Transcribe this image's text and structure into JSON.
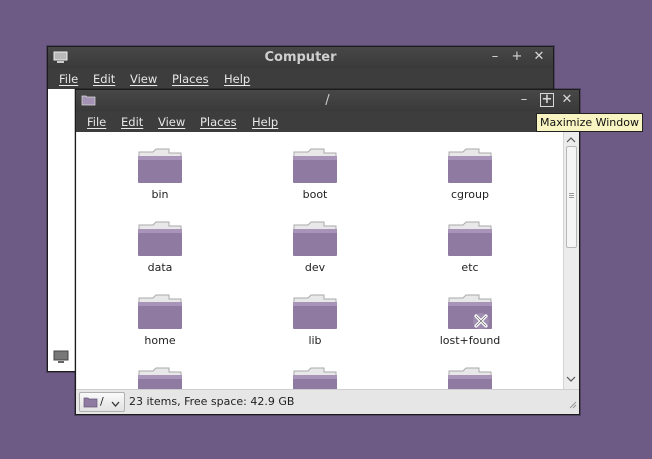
{
  "back_window": {
    "title": "Computer",
    "menu": [
      "File",
      "Edit",
      "View",
      "Places",
      "Help"
    ],
    "controls": {
      "minimize": "–",
      "maximize": "+",
      "close": "✕"
    }
  },
  "front_window": {
    "title": "/",
    "menu": [
      "File",
      "Edit",
      "View",
      "Places",
      "Help"
    ],
    "controls": {
      "minimize": "–",
      "maximize": "+",
      "close": "✕"
    },
    "files": [
      {
        "name": "bin"
      },
      {
        "name": "boot"
      },
      {
        "name": "cgroup"
      },
      {
        "name": "data"
      },
      {
        "name": "dev"
      },
      {
        "name": "etc"
      },
      {
        "name": "home"
      },
      {
        "name": "lib"
      },
      {
        "name": "lost+found",
        "badge": "unreadable"
      }
    ],
    "status": {
      "location": "/",
      "summary": "23 items, Free space: 42.9 GB"
    }
  },
  "tooltip": "Maximize Window",
  "colors": {
    "desktop": "#6d5a85",
    "folder": "#8f7aa1"
  }
}
